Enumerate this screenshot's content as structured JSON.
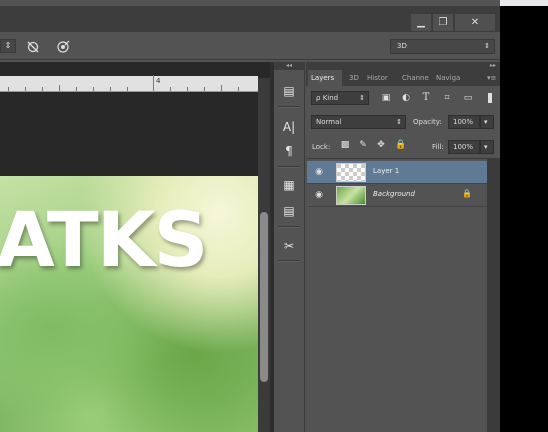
{
  "window": {
    "minimize_glyph": "▁",
    "restore_glyph": "❐",
    "close_glyph": "✕"
  },
  "options_bar": {
    "mode_select": "3D",
    "icons": [
      "stepper-icon",
      "no-3d-icon",
      "target-icon"
    ]
  },
  "ruler": {
    "label": "4"
  },
  "canvas": {
    "text": "ATKS"
  },
  "panel_strip": {
    "collapse_glyph": "◂◂",
    "items": [
      {
        "icon": "history-brush-icon",
        "glyph": "▤"
      },
      {
        "icon": "character-icon",
        "glyph": "A|"
      },
      {
        "icon": "paragraph-icon",
        "glyph": "¶"
      },
      {
        "icon": "swatches-icon",
        "glyph": "▦"
      },
      {
        "icon": "notes-icon",
        "glyph": "▤"
      },
      {
        "icon": "tools-icon",
        "glyph": "✂"
      }
    ]
  },
  "layers_panel": {
    "expand_glyph": "▸▸",
    "tabs": [
      "Layers",
      "3D",
      "Histor",
      "Channe",
      "Naviga"
    ],
    "filter": {
      "label": "Kind",
      "search_glyph": "ρ"
    },
    "filter_icons": [
      "image-filter-icon",
      "adjustment-filter-icon",
      "type-filter-icon",
      "shape-filter-icon",
      "smart-object-filter-icon"
    ],
    "blend_mode": "Normal",
    "opacity_label": "Opacity:",
    "opacity_value": "100%",
    "lock_label": "Lock:",
    "fill_label": "Fill:",
    "fill_value": "100%",
    "layers": [
      {
        "name": "Layer 1",
        "selected": true,
        "visible": true
      },
      {
        "name": "Background",
        "selected": false,
        "visible": true,
        "locked": true
      }
    ]
  },
  "colors": {
    "panel_bg": "#535353",
    "dark_bg": "#282828",
    "selection": "#5f7a95"
  }
}
